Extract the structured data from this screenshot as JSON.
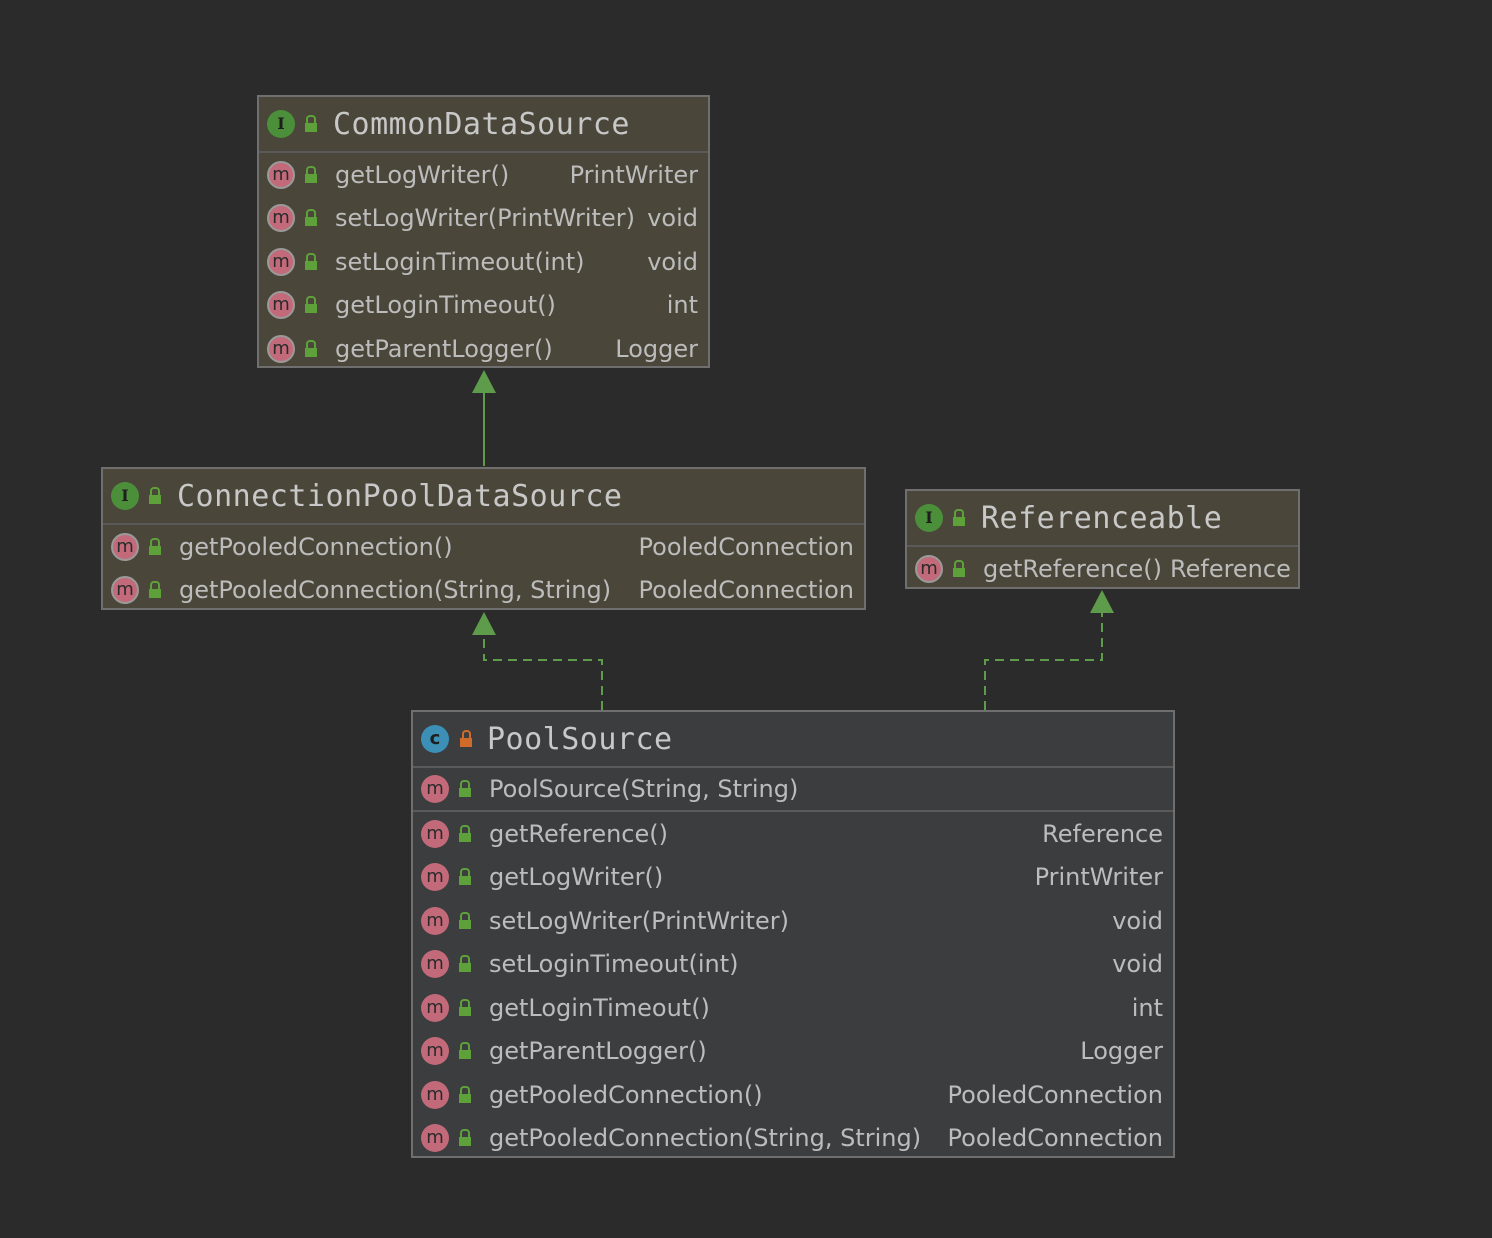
{
  "colors": {
    "background": "#2b2b2b",
    "interface_fill": "#4a4639",
    "class_fill": "#3b3d3f",
    "arrow": "#5e9b4a"
  },
  "nodes": {
    "common": {
      "title": "CommonDataSource",
      "kind_icon": "interface-icon",
      "methods": [
        {
          "name": "getLogWriter()",
          "type": "PrintWriter"
        },
        {
          "name": "setLogWriter(PrintWriter)",
          "type": "void"
        },
        {
          "name": "setLoginTimeout(int)",
          "type": "void"
        },
        {
          "name": "getLoginTimeout()",
          "type": "int"
        },
        {
          "name": "getParentLogger()",
          "type": "Logger"
        }
      ]
    },
    "cpds": {
      "title": "ConnectionPoolDataSource",
      "kind_icon": "interface-icon",
      "methods": [
        {
          "name": "getPooledConnection()",
          "type": "PooledConnection"
        },
        {
          "name": "getPooledConnection(String, String)",
          "type": "PooledConnection"
        }
      ]
    },
    "ref": {
      "title": "Referenceable",
      "kind_icon": "interface-icon",
      "methods": [
        {
          "name": "getReference()",
          "type": "Reference"
        }
      ]
    },
    "pool": {
      "title": "PoolSource",
      "kind_icon": "class-icon",
      "constructor": {
        "name": "PoolSource(String, String)"
      },
      "methods": [
        {
          "name": "getReference()",
          "type": "Reference"
        },
        {
          "name": "getLogWriter()",
          "type": "PrintWriter"
        },
        {
          "name": "setLogWriter(PrintWriter)",
          "type": "void"
        },
        {
          "name": "setLoginTimeout(int)",
          "type": "void"
        },
        {
          "name": "getLoginTimeout()",
          "type": "int"
        },
        {
          "name": "getParentLogger()",
          "type": "Logger"
        },
        {
          "name": "getPooledConnection()",
          "type": "PooledConnection"
        },
        {
          "name": "getPooledConnection(String, String)",
          "type": "PooledConnection"
        }
      ]
    }
  },
  "edges": [
    {
      "from": "ConnectionPoolDataSource",
      "to": "CommonDataSource",
      "kind": "extends"
    },
    {
      "from": "PoolSource",
      "to": "ConnectionPoolDataSource",
      "kind": "implements"
    },
    {
      "from": "PoolSource",
      "to": "Referenceable",
      "kind": "implements"
    }
  ],
  "badges": {
    "interface": "I",
    "method": "m",
    "class": "c"
  }
}
